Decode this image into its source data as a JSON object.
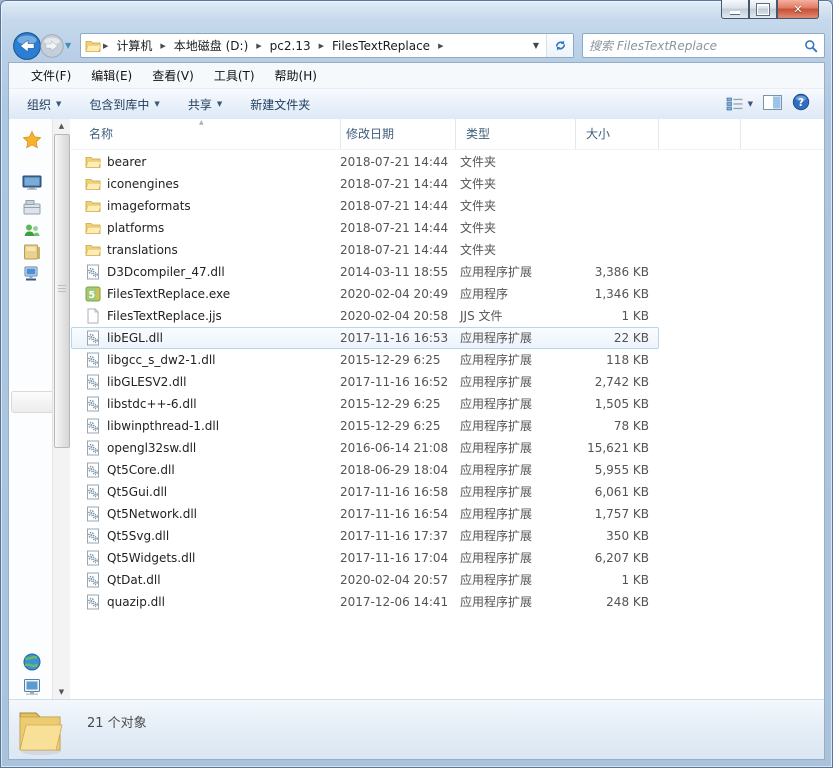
{
  "window": {
    "accent_color": "#b7cee6",
    "close_glyph": "✕"
  },
  "icons": {
    "breadcrumb_arrow": "▶",
    "dropdown_arrow": "▼",
    "sort_asc": "▲",
    "scroll_up": "▲",
    "scroll_down": "▼",
    "history_arrow": "▼"
  },
  "navigation": {
    "breadcrumb": [
      {
        "label": "计算机"
      },
      {
        "label": "本地磁盘 (D:)"
      },
      {
        "label": "pc2.13"
      },
      {
        "label": "FilesTextReplace"
      }
    ],
    "search": {
      "placeholder": "搜索 FilesTextReplace"
    }
  },
  "menubar": {
    "items": [
      {
        "label": "文件(F)"
      },
      {
        "label": "编辑(E)"
      },
      {
        "label": "查看(V)"
      },
      {
        "label": "工具(T)"
      },
      {
        "label": "帮助(H)"
      }
    ]
  },
  "toolbar": {
    "buttons": [
      {
        "label": "组织",
        "dropdown": true
      },
      {
        "label": "包含到库中",
        "dropdown": true
      },
      {
        "label": "共享",
        "dropdown": true
      },
      {
        "label": "新建文件夹",
        "dropdown": false
      }
    ]
  },
  "list": {
    "columns": [
      {
        "label": "名称",
        "sort": "asc"
      },
      {
        "label": "修改日期"
      },
      {
        "label": "类型"
      },
      {
        "label": "大小"
      }
    ],
    "files": [
      {
        "name": "bearer",
        "date": "2018-07-21 14:44",
        "type": "文件夹",
        "size": "",
        "icon": "folder-icon"
      },
      {
        "name": "iconengines",
        "date": "2018-07-21 14:44",
        "type": "文件夹",
        "size": "",
        "icon": "folder-icon"
      },
      {
        "name": "imageformats",
        "date": "2018-07-21 14:44",
        "type": "文件夹",
        "size": "",
        "icon": "folder-icon"
      },
      {
        "name": "platforms",
        "date": "2018-07-21 14:44",
        "type": "文件夹",
        "size": "",
        "icon": "folder-icon"
      },
      {
        "name": "translations",
        "date": "2018-07-21 14:44",
        "type": "文件夹",
        "size": "",
        "icon": "folder-icon"
      },
      {
        "name": "D3Dcompiler_47.dll",
        "date": "2014-03-11 18:55",
        "type": "应用程序扩展",
        "size": "3,386 KB",
        "icon": "dll-icon"
      },
      {
        "name": "FilesTextReplace.exe",
        "date": "2020-02-04 20:49",
        "type": "应用程序",
        "size": "1,346 KB",
        "icon": "exe-icon"
      },
      {
        "name": "FilesTextReplace.jjs",
        "date": "2020-02-04 20:58",
        "type": "JJS 文件",
        "size": "1 KB",
        "icon": "jjs-icon"
      },
      {
        "name": "libEGL.dll",
        "date": "2017-11-16 16:53",
        "type": "应用程序扩展",
        "size": "22 KB",
        "icon": "dll-icon",
        "highlighted": true
      },
      {
        "name": "libgcc_s_dw2-1.dll",
        "date": "2015-12-29 6:25",
        "type": "应用程序扩展",
        "size": "118 KB",
        "icon": "dll-icon"
      },
      {
        "name": "libGLESV2.dll",
        "date": "2017-11-16 16:52",
        "type": "应用程序扩展",
        "size": "2,742 KB",
        "icon": "dll-icon"
      },
      {
        "name": "libstdc++-6.dll",
        "date": "2015-12-29 6:25",
        "type": "应用程序扩展",
        "size": "1,505 KB",
        "icon": "dll-icon"
      },
      {
        "name": "libwinpthread-1.dll",
        "date": "2015-12-29 6:25",
        "type": "应用程序扩展",
        "size": "78 KB",
        "icon": "dll-icon"
      },
      {
        "name": "opengl32sw.dll",
        "date": "2016-06-14 21:08",
        "type": "应用程序扩展",
        "size": "15,621 KB",
        "icon": "dll-icon"
      },
      {
        "name": "Qt5Core.dll",
        "date": "2018-06-29 18:04",
        "type": "应用程序扩展",
        "size": "5,955 KB",
        "icon": "dll-icon"
      },
      {
        "name": "Qt5Gui.dll",
        "date": "2017-11-16 16:58",
        "type": "应用程序扩展",
        "size": "6,061 KB",
        "icon": "dll-icon"
      },
      {
        "name": "Qt5Network.dll",
        "date": "2017-11-16 16:54",
        "type": "应用程序扩展",
        "size": "1,757 KB",
        "icon": "dll-icon"
      },
      {
        "name": "Qt5Svg.dll",
        "date": "2017-11-16 17:37",
        "type": "应用程序扩展",
        "size": "350 KB",
        "icon": "dll-icon"
      },
      {
        "name": "Qt5Widgets.dll",
        "date": "2017-11-16 17:04",
        "type": "应用程序扩展",
        "size": "6,207 KB",
        "icon": "dll-icon"
      },
      {
        "name": "QtDat.dll",
        "date": "2020-02-04 20:57",
        "type": "应用程序扩展",
        "size": "1 KB",
        "icon": "dll-icon"
      },
      {
        "name": "quazip.dll",
        "date": "2017-12-06 14:41",
        "type": "应用程序扩展",
        "size": "248 KB",
        "icon": "dll-icon"
      }
    ]
  },
  "statusbar": {
    "text": "21 个对象"
  }
}
